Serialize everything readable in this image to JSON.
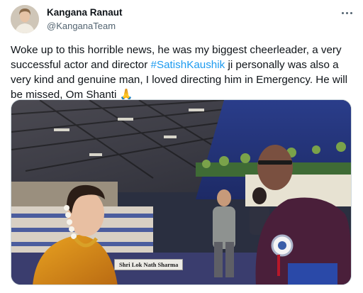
{
  "author": {
    "name": "Kangana Ranaut",
    "handle": "@KanganaTeam"
  },
  "tweet": {
    "text_part1": "Woke up to this horrible news, he was my biggest cheerleader, a very successful actor and director ",
    "hashtag": "#SatishKaushik",
    "text_part2": " ji personally was also a very kind and genuine man, I loved directing him in Emergency. He will be missed, Om Shanti 🙏"
  },
  "media": {
    "nameplate_text": "Shri Lok Nath Sharma"
  },
  "icons": {
    "more": "more-options-icon"
  },
  "colors": {
    "link": "#1d9bf0",
    "secondary_text": "#536471",
    "primary_text": "#0f1419"
  }
}
